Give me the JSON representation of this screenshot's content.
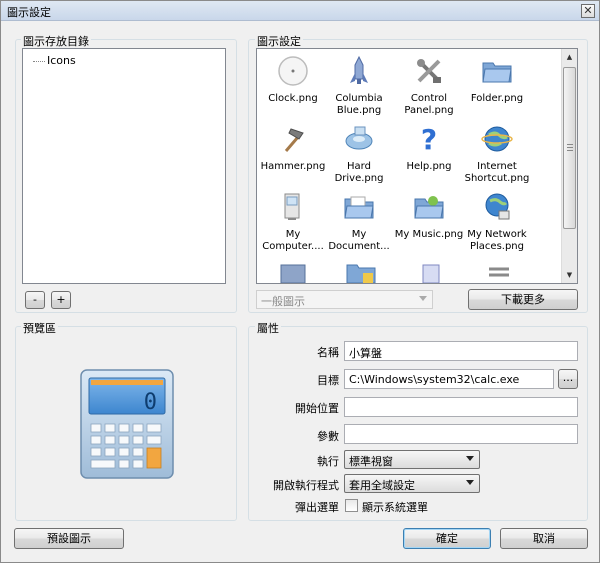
{
  "window": {
    "title": "圖示設定",
    "close_symbol": "✕"
  },
  "left_panel": {
    "title": "圖示存放目錄",
    "tree_items": [
      "Icons"
    ],
    "remove_label": "-",
    "add_label": "+"
  },
  "icon_panel": {
    "title": "圖示設定",
    "icons": [
      {
        "label": "Clock.png",
        "icon": "clock-icon"
      },
      {
        "label": "Columbia Blue.png",
        "icon": "rocket-icon"
      },
      {
        "label": "Control Panel.png",
        "icon": "control-panel-icon"
      },
      {
        "label": "Folder.png",
        "icon": "folder-icon"
      },
      {
        "label": "Hammer.png",
        "icon": "hammer-icon"
      },
      {
        "label": "Hard Drive.png",
        "icon": "hard-drive-icon"
      },
      {
        "label": "Help.png",
        "icon": "help-icon"
      },
      {
        "label": "Internet Shortcut.png",
        "icon": "globe-icon"
      },
      {
        "label": "My Computer....",
        "icon": "computer-icon"
      },
      {
        "label": "My Document...",
        "icon": "documents-folder-icon"
      },
      {
        "label": "My Music.png",
        "icon": "music-folder-icon"
      },
      {
        "label": "My Network Places.png",
        "icon": "network-icon"
      }
    ],
    "category_select": "一般圖示",
    "download_more": "下載更多"
  },
  "preview_panel": {
    "title": "預覽區",
    "preview_icon": "calculator-icon"
  },
  "properties": {
    "title": "屬性",
    "name_label": "名稱",
    "name_value": "小算盤",
    "target_label": "目標",
    "target_value": "C:\\Windows\\system32\\calc.exe",
    "browse_label": "...",
    "start_in_label": "開始位置",
    "start_in_value": "",
    "params_label": "參數",
    "params_value": "",
    "run_label": "執行",
    "run_value": "標準視窗",
    "open_with_label": "開啟執行程式",
    "open_with_value": "套用全域設定",
    "popup_label": "彈出選單",
    "show_system_menu_label": "顯示系統選單",
    "show_system_menu_checked": false
  },
  "footer": {
    "default_icon": "預設圖示",
    "ok": "確定",
    "cancel": "取消"
  }
}
